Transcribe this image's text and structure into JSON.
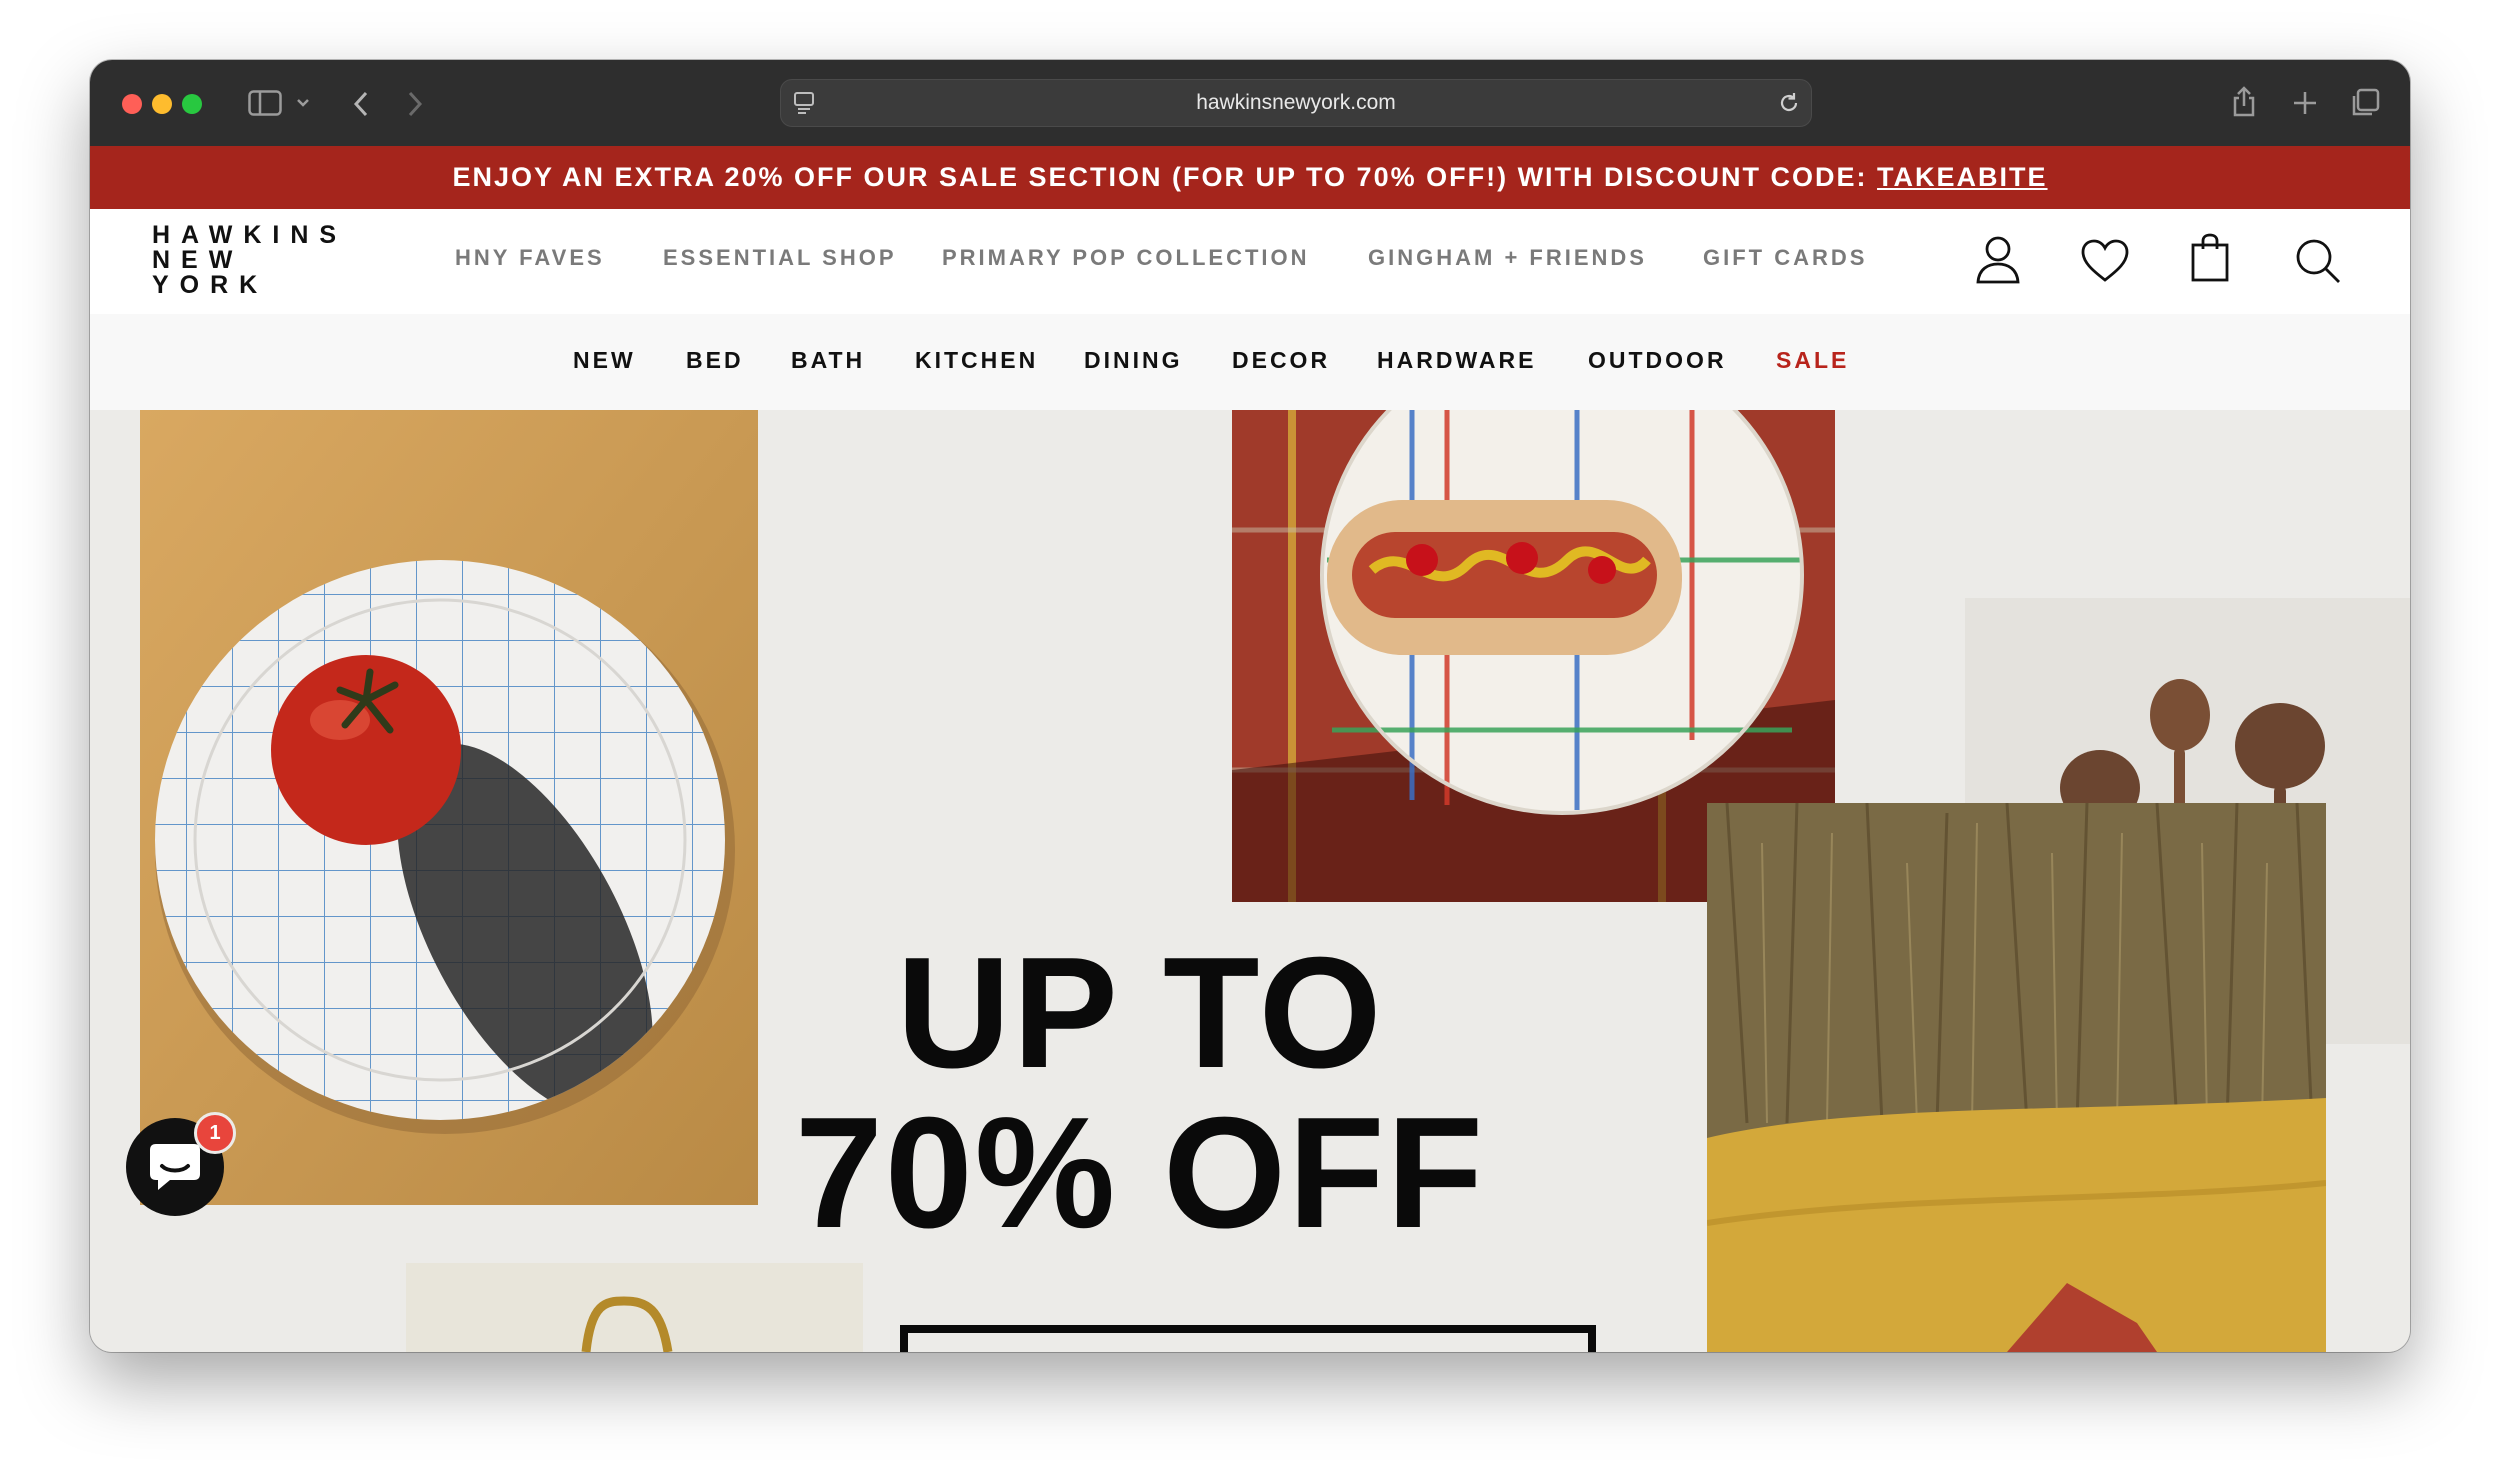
{
  "browser": {
    "url": "hawkinsnewyork.com"
  },
  "promo": {
    "text": "ENJOY AN EXTRA 20% OFF OUR SALE SECTION (FOR UP TO 70% OFF!) WITH DISCOUNT CODE: ",
    "code": "TAKEABITE"
  },
  "logo": {
    "line1": "HAWKINS",
    "line2": "NEW",
    "line3": "YORK"
  },
  "top_nav": [
    "HNY FAVES",
    "ESSENTIAL SHOP",
    "PRIMARY POP COLLECTION",
    "GINGHAM + FRIENDS",
    "GIFT CARDS"
  ],
  "category_nav": [
    "NEW",
    "BED",
    "BATH",
    "KITCHEN",
    "DINING",
    "DECOR",
    "HARDWARE",
    "OUTDOOR",
    "SALE"
  ],
  "hero": {
    "headline_line1": "UP TO",
    "headline_line2": "70% OFF"
  },
  "chat": {
    "badge_count": "1"
  },
  "colors": {
    "promo_bg": "#a5251c",
    "sale_link": "#b8241c",
    "hero_bg": "#ecebe8"
  },
  "icons": [
    "sidebar-icon",
    "chevron-down-icon",
    "back-icon",
    "forward-icon",
    "site-settings-icon",
    "reload-icon",
    "share-icon",
    "new-tab-icon",
    "tabs-overview-icon",
    "account-icon",
    "wishlist-heart-icon",
    "shopping-bag-icon",
    "search-icon",
    "chat-icon"
  ]
}
